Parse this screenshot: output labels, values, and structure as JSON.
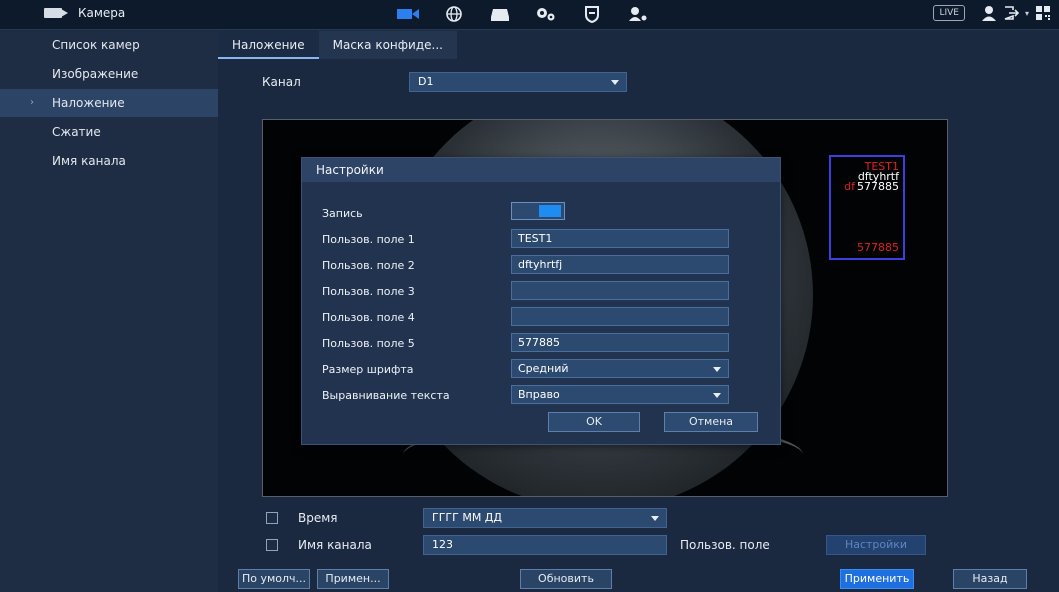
{
  "header": {
    "title": "Камера",
    "live_label": "LIVE",
    "nav_icons": [
      "camera-icon",
      "network-icon",
      "storage-icon",
      "settings-icon",
      "security-icon",
      "account-icon"
    ]
  },
  "sidebar": {
    "items": [
      {
        "label": "Список камер",
        "active": false
      },
      {
        "label": "Изображение",
        "active": false
      },
      {
        "label": "Наложение",
        "active": true
      },
      {
        "label": "Сжатие",
        "active": false
      },
      {
        "label": "Имя канала",
        "active": false
      }
    ]
  },
  "tabs": [
    {
      "label": "Наложение",
      "active": true
    },
    {
      "label": "Маска конфиде...",
      "active": false
    }
  ],
  "channel": {
    "label": "Канал",
    "value": "D1"
  },
  "preview_overlay": {
    "lines": [
      "TEST1",
      "dftyhrtf",
      "577885"
    ],
    "partial_red": "df",
    "bottom_value": "577885"
  },
  "dialog": {
    "title": "Настройки",
    "record_label": "Запись",
    "record_enabled": true,
    "fields": [
      {
        "label": "Пользов. поле 1",
        "value": "TEST1"
      },
      {
        "label": "Пользов. поле 2",
        "value": "dftyhrtfj"
      },
      {
        "label": "Пользов. поле 3",
        "value": ""
      },
      {
        "label": "Пользов. поле 4",
        "value": ""
      },
      {
        "label": "Пользов. поле 5",
        "value": "577885"
      }
    ],
    "font_size_label": "Размер шрифта",
    "font_size_value": "Средний",
    "align_label": "Выравнивание текста",
    "align_value": "Вправо",
    "ok_label": "OK",
    "cancel_label": "Отмена"
  },
  "bottom": {
    "time_label": "Время",
    "time_format": "ГГГГ ММ ДД",
    "channel_name_label": "Имя канала",
    "channel_name_value": "123",
    "custom_field_label": "Пользов. поле",
    "settings_button": "Настройки",
    "default_button": "По умолч...",
    "apply_to_button": "Примен...",
    "refresh_button": "Обновить",
    "apply_button": "Применить",
    "back_button": "Назад"
  },
  "colors": {
    "accent": "#1e6fe0",
    "overlay_red": "#e02020",
    "overlay_box": "#3b3fe0"
  }
}
